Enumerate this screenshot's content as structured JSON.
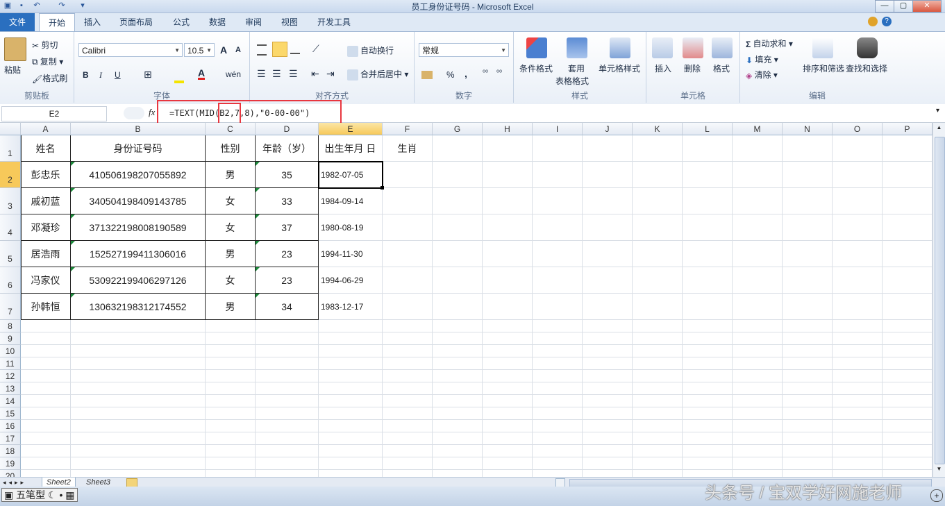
{
  "window": {
    "title": "员工身份证号码 - Microsoft Excel",
    "min_symbol": "—",
    "max_symbol": "▢",
    "close_symbol": "✕"
  },
  "ribbon_tabs": [
    "文件",
    "开始",
    "插入",
    "页面布局",
    "公式",
    "数据",
    "审阅",
    "视图",
    "开发工具"
  ],
  "ribbon": {
    "clipboard": {
      "paste": "粘贴",
      "cut": "剪切",
      "copy": "复制",
      "format_painter": "格式刷",
      "label": "剪贴板"
    },
    "font": {
      "name": "Calibri",
      "size": "10.5",
      "bold": "B",
      "italic": "I",
      "underline": "U",
      "grow": "A",
      "shrink": "A",
      "label": "字体"
    },
    "alignment": {
      "wrap": "自动换行",
      "merge": "合并后居中",
      "label": "对齐方式"
    },
    "number": {
      "format": "常规",
      "percent": "%",
      "comma": ",",
      "label": "数字"
    },
    "styles": {
      "conditional": "条件格式",
      "table_line1": "套用",
      "table_line2": "表格格式",
      "cell_styles": "单元格样式",
      "label": "样式"
    },
    "cells": {
      "insert": "插入",
      "delete": "删除",
      "format": "格式",
      "label": "单元格"
    },
    "editing": {
      "autosum": "自动求和",
      "fill": "填充",
      "clear": "清除",
      "sort": "排序和筛选",
      "find": "查找和选择",
      "label": "编辑"
    }
  },
  "formula_bar": {
    "name_box": "E2",
    "fx": "fx",
    "formula_part1": "=TEXT(MID(",
    "formula_part2": "B2",
    "formula_part3": ",7,8),\"0-00-00\")"
  },
  "columns": [
    "A",
    "B",
    "C",
    "D",
    "E",
    "F",
    "G",
    "H",
    "I",
    "J",
    "K",
    "L",
    "M",
    "N",
    "O",
    "P"
  ],
  "row_numbers": [
    "1",
    "2",
    "3",
    "4",
    "5",
    "6",
    "7",
    "8",
    "9",
    "10",
    "11",
    "12",
    "13",
    "14",
    "15",
    "16",
    "17",
    "18",
    "19",
    "20"
  ],
  "headers": [
    "姓名",
    "身份证号码",
    "性别",
    "年龄（岁）",
    "出生年月 日",
    "生肖"
  ],
  "rows": [
    {
      "name": "彭忠乐",
      "id": "410506198207055892",
      "gender": "男",
      "age": "35",
      "birth": "1982-07-05"
    },
    {
      "name": "戚初蓝",
      "id": "340504198409143785",
      "gender": "女",
      "age": "33",
      "birth": "1984-09-14"
    },
    {
      "name": "邓凝珍",
      "id": "371322198008190589",
      "gender": "女",
      "age": "37",
      "birth": "1980-08-19"
    },
    {
      "name": "居浩雨",
      "id": "152527199411306016",
      "gender": "男",
      "age": "23",
      "birth": "1994-11-30"
    },
    {
      "name": "冯家仪",
      "id": "530922199406297126",
      "gender": "女",
      "age": "23",
      "birth": "1994-06-29"
    },
    {
      "name": "孙韩恒",
      "id": "130632198312174552",
      "gender": "男",
      "age": "34",
      "birth": "1983-12-17"
    }
  ],
  "sheet_tabs": [
    "Sheet2",
    "Sheet3"
  ],
  "ime": {
    "label": "五笔型"
  },
  "watermark": "头条号 / 宝双学好网施老师",
  "colors": {
    "file_tab": "#2a6fbf",
    "highlight": "#e8363f",
    "selected_header": "#f7c95a",
    "green_triangle": "#1b8a3a"
  }
}
